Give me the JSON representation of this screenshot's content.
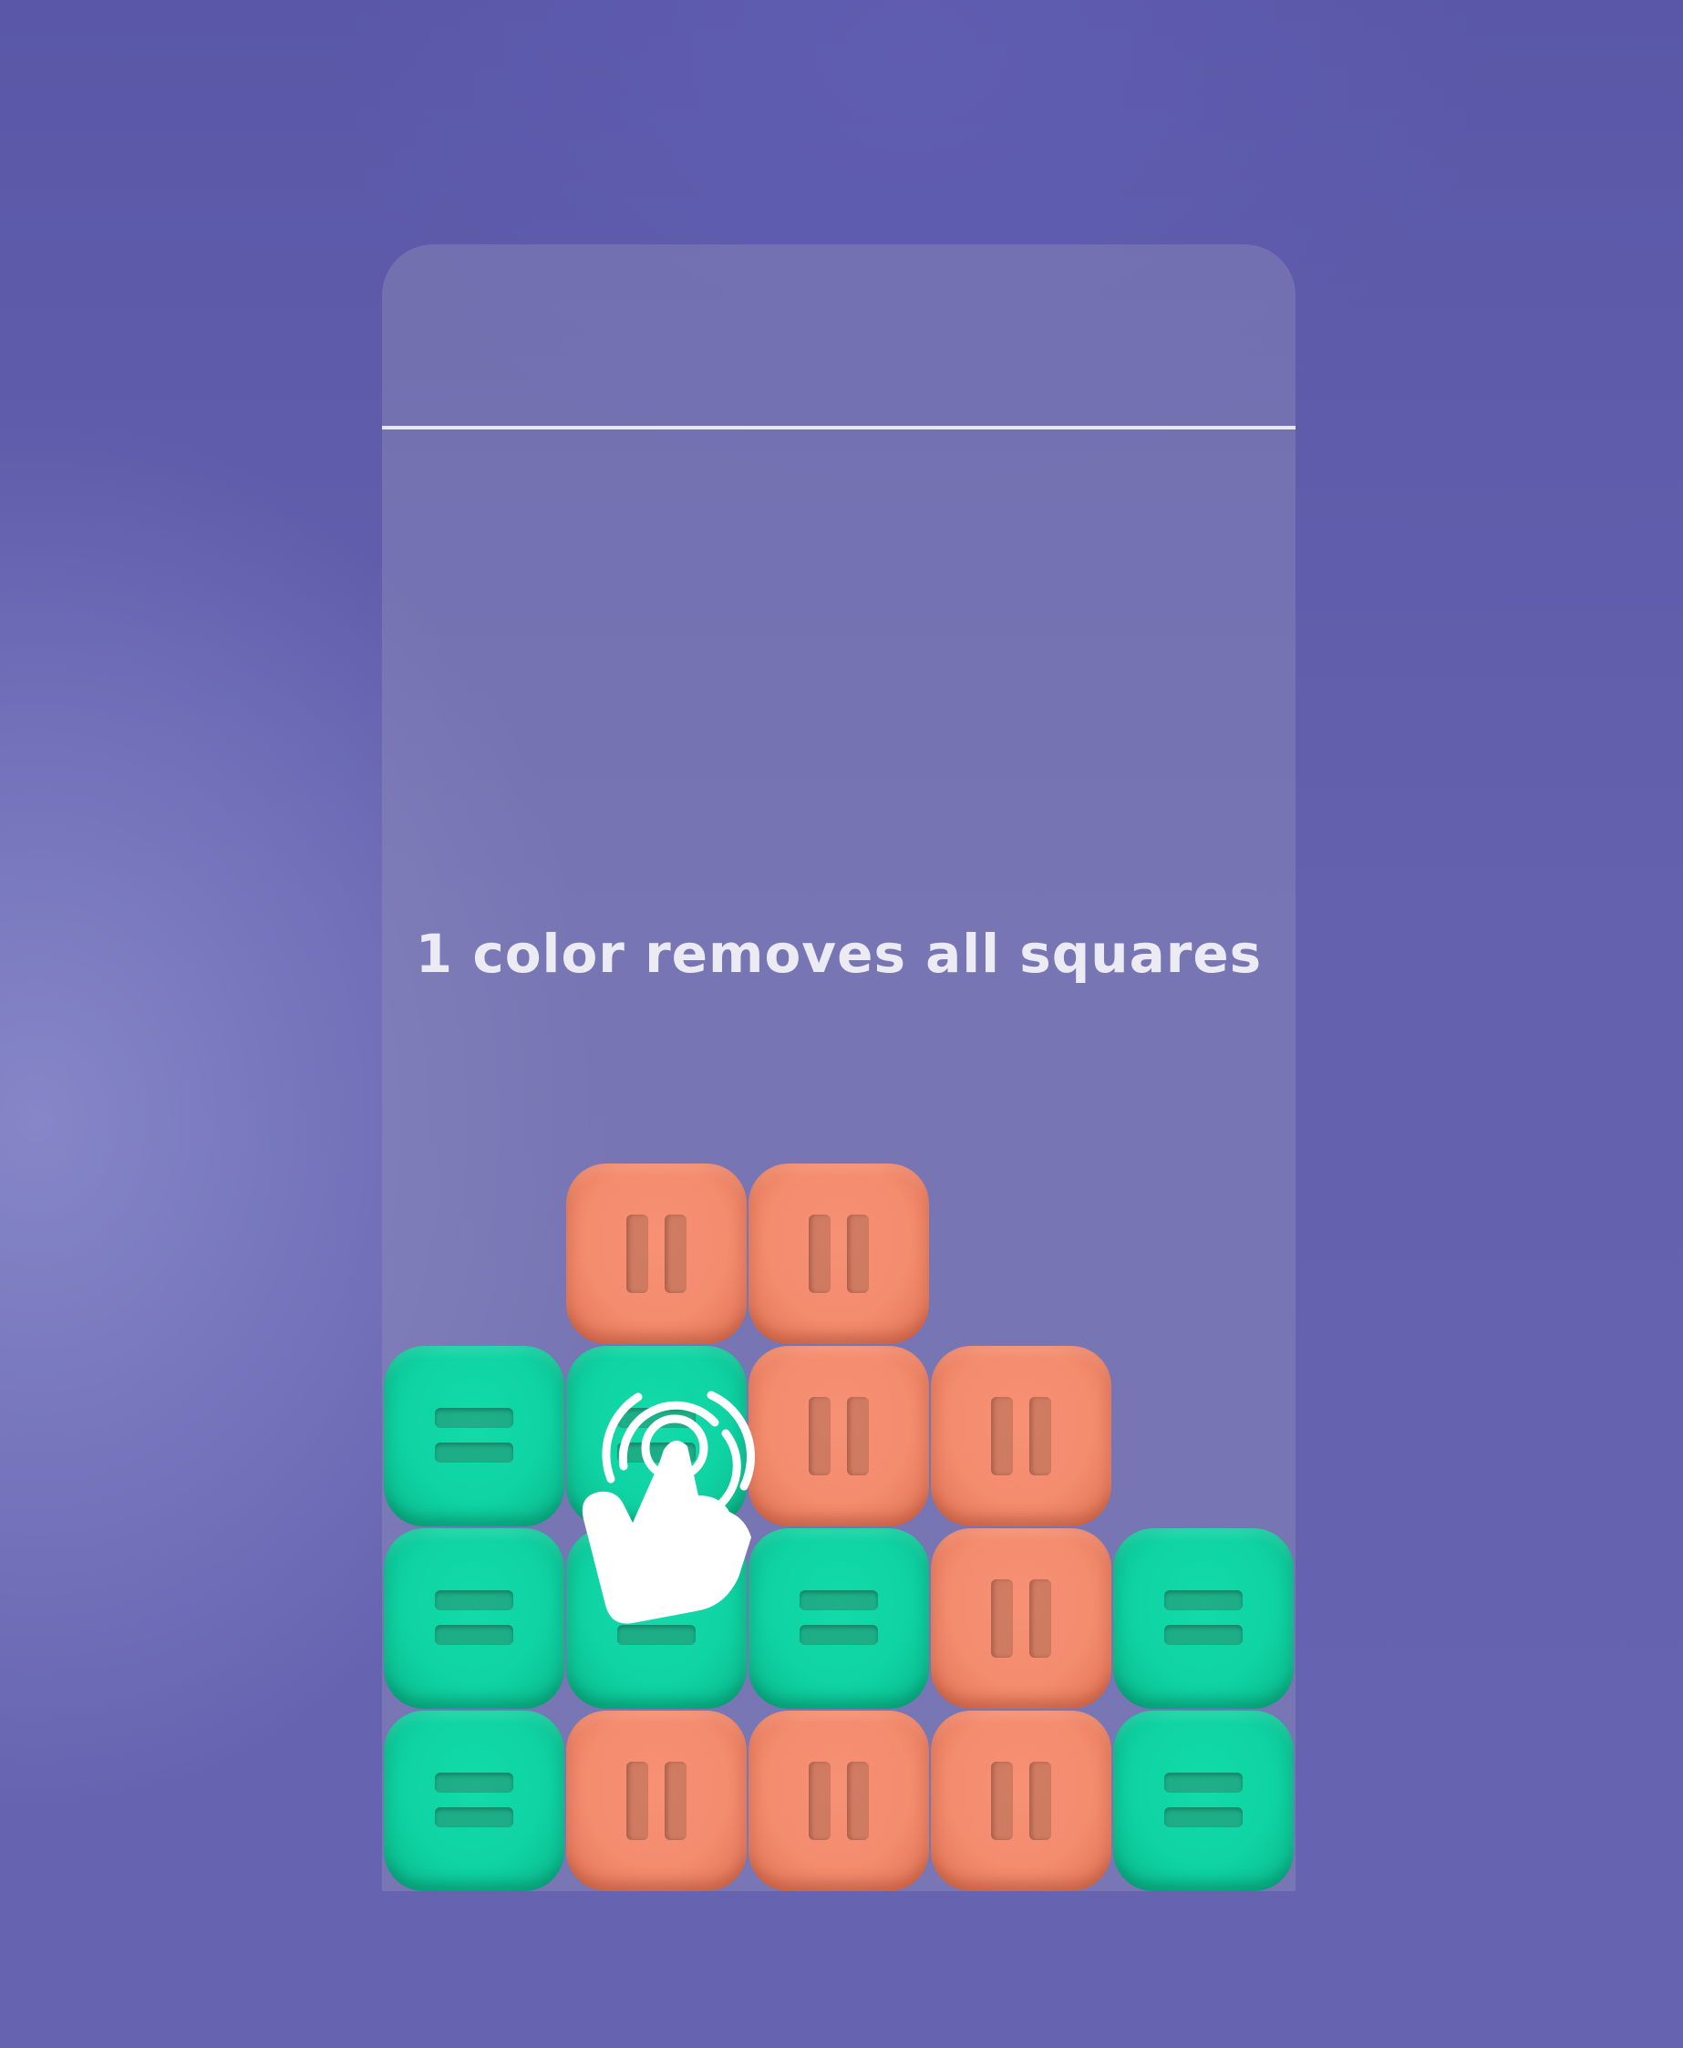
{
  "hint_text": "1 color removes all squares",
  "board": {
    "columns": 5,
    "rows": 4,
    "grid": [
      [
        "",
        "orange",
        "orange",
        "",
        ""
      ],
      [
        "teal",
        "teal",
        "orange",
        "orange",
        ""
      ],
      [
        "teal",
        "teal",
        "teal",
        "orange",
        "teal"
      ],
      [
        "teal",
        "orange",
        "orange",
        "orange",
        "teal"
      ]
    ]
  },
  "tutorial_pointer": {
    "icon": "tap-hand-icon",
    "target_row": 2,
    "target_column": 2
  },
  "colors": {
    "teal": "#0fd3a3",
    "orange": "#f48c6e",
    "background": "#5f5cab",
    "text": "#ecebf4"
  }
}
